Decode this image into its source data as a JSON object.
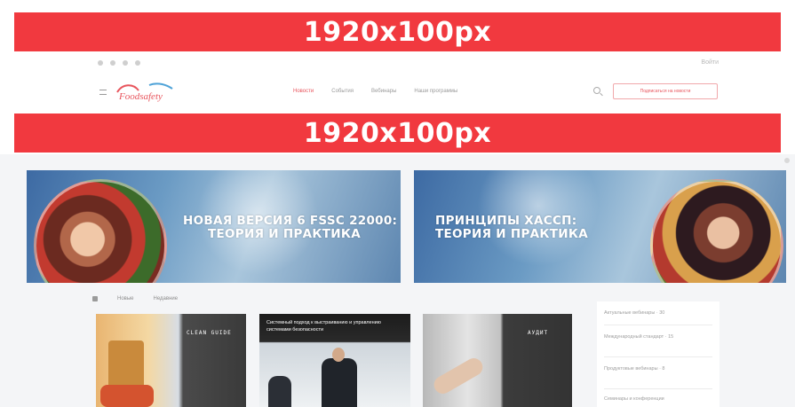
{
  "overlay_labels": {
    "top": "1920x100px",
    "middle": "1920x100px"
  },
  "colors": {
    "overlay_red": "#f1393f",
    "accent": "#e8555d",
    "content_bg": "#f4f5f7"
  },
  "topbar": {
    "social_icons": [
      "vk-icon",
      "facebook-icon",
      "instagram-icon",
      "youtube-icon"
    ],
    "login": "Войти"
  },
  "header": {
    "logo_text": "Foodsafety",
    "tagline": "",
    "nav": [
      "Новости",
      "События",
      "Вебинары",
      "Наши программы"
    ],
    "search_icon": "search-icon",
    "cta": "Подписаться на новости"
  },
  "heroes": [
    {
      "kicker": "",
      "headline_line1": "НОВАЯ ВЕРСИЯ 6 FSSC 22000:",
      "headline_line2": "ТЕОРИЯ И ПРАКТИКА",
      "desc": ""
    },
    {
      "kicker": "",
      "headline_line1": "ПРИНЦИПЫ ХАССП:",
      "headline_line2": "ТЕОРИЯ И ПРАКТИКА",
      "desc": ""
    }
  ],
  "filters": {
    "items": [
      "Новые",
      "Недавние"
    ]
  },
  "cards": [
    {
      "title": "CLEAN GUIDE",
      "subtitle": ""
    },
    {
      "title": "Системный подход к выстраиванию и управлению системами безопасности",
      "subtitle": ""
    },
    {
      "title": "АУДИТ",
      "subtitle": ""
    }
  ],
  "sidebar": {
    "items": [
      "Актуальные вебинары · 30",
      "Международный стандарт · 15",
      "Продуктовые вебинары · 8",
      "Семинары и конференции"
    ]
  }
}
